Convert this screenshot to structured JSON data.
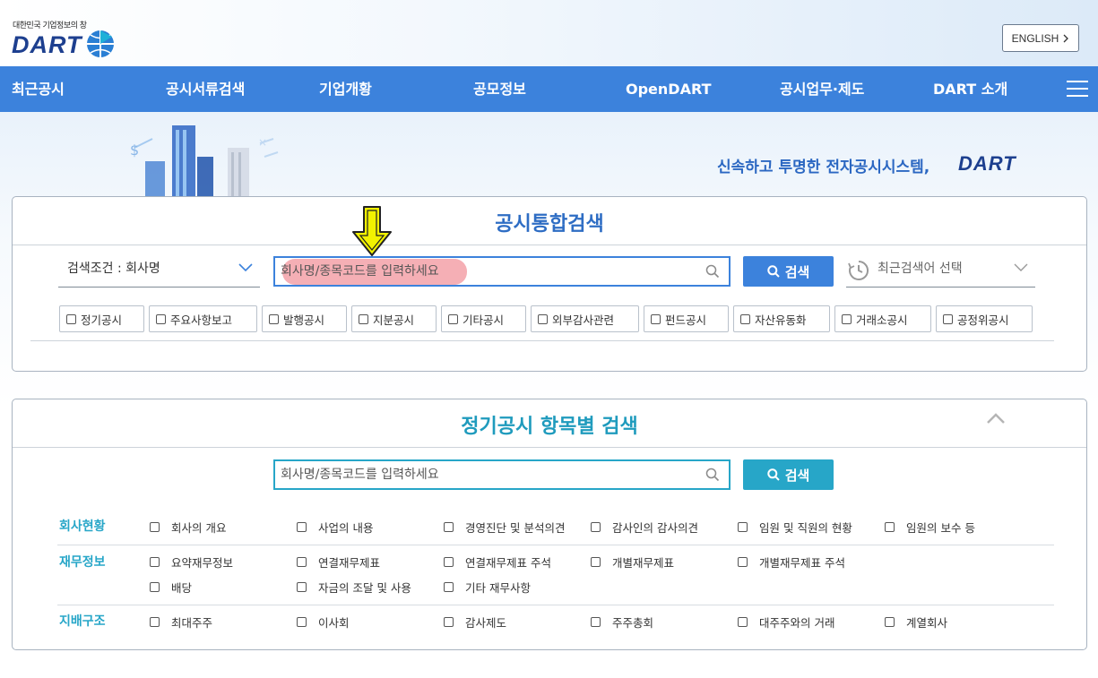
{
  "header": {
    "tagline": "대한민국 기업정보의 창",
    "logo_text": "DART",
    "english_label": "ENGLISH"
  },
  "nav": {
    "items": [
      "최근공시",
      "공시서류검색",
      "기업개황",
      "공모정보",
      "OpenDART",
      "공시업무·제도",
      "DART 소개"
    ]
  },
  "banner": {
    "slogan": "신속하고 투명한 전자공시시스템,",
    "slogan_logo": "DART"
  },
  "integrated_search": {
    "title": "공시통합검색",
    "condition_label": "검색조건 : 회사명",
    "search_placeholder": "회사명/종목코드를 입력하세요",
    "search_button": "검색",
    "recent_label": "최근검색어 선택",
    "filters": [
      "정기공시",
      "주요사항보고",
      "발행공시",
      "지분공시",
      "기타공시",
      "외부감사관련",
      "펀드공시",
      "자산유동화",
      "거래소공시",
      "공정위공시"
    ]
  },
  "periodic_search": {
    "title": "정기공시 항목별 검색",
    "search_placeholder": "회사명/종목코드를 입력하세요",
    "search_button": "검색",
    "categories": [
      {
        "label": "회사현황",
        "items": [
          "회사의 개요",
          "사업의 내용",
          "경영진단 및 분석의견",
          "감사인의 감사의견",
          "임원 및 직원의 현황",
          "임원의 보수 등"
        ]
      },
      {
        "label": "재무정보",
        "items": [
          "요약재무정보",
          "연결재무제표",
          "연결재무제표 주석",
          "개별재무제표",
          "개별재무제표 주석",
          "배당",
          "자금의 조달 및 사용",
          "기타 재무사항"
        ]
      },
      {
        "label": "지배구조",
        "items": [
          "최대주주",
          "이사회",
          "감사제도",
          "주주총회",
          "대주주와의 거래",
          "계열회사"
        ]
      }
    ]
  },
  "colors": {
    "nav_bg": "#3c82dc",
    "title_blue": "#2e6dc4",
    "teal": "#27a6c8",
    "arrow_yellow": "#f2f200",
    "highlight": "#f4a6ad"
  }
}
